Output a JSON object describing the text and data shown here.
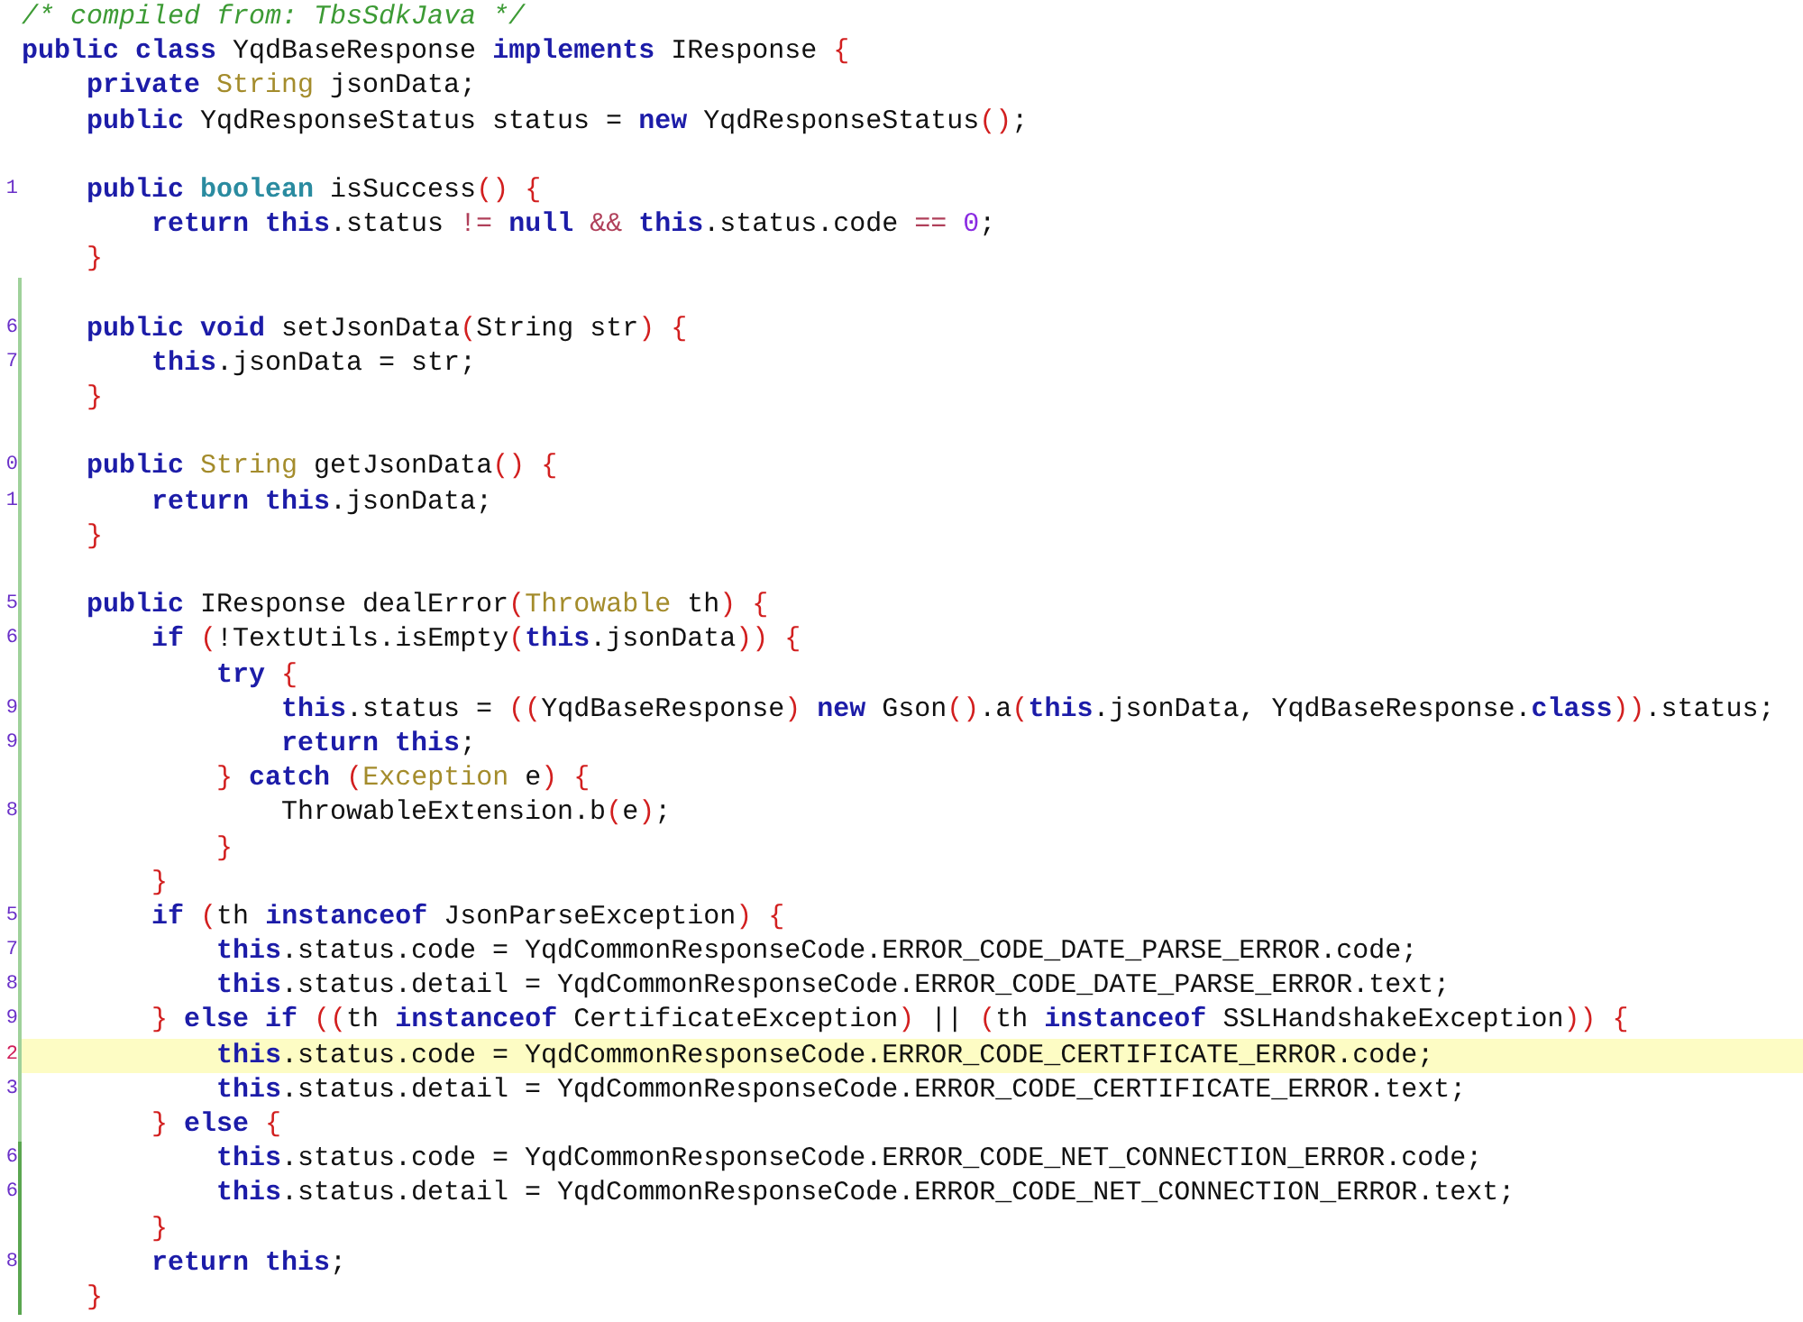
{
  "editor": {
    "lines": [
      {
        "kind": "code",
        "tokens": [
          {
            "kind": "comment",
            "text": "/* compiled from: TbsSdkJava */"
          }
        ]
      },
      {
        "kind": "code",
        "tokens": [
          {
            "kind": "keyword",
            "text": "public class"
          },
          {
            "kind": "plain",
            "text": " YqdBaseResponse "
          },
          {
            "kind": "keyword",
            "text": "implements"
          },
          {
            "kind": "plain",
            "text": " IResponse "
          },
          {
            "kind": "bracket",
            "text": "{"
          }
        ]
      },
      {
        "kind": "code",
        "tokens": [
          {
            "kind": "keyword",
            "text": "    private "
          },
          {
            "kind": "type",
            "text": "String"
          },
          {
            "kind": "plain",
            "text": " jsonData;"
          }
        ]
      },
      {
        "kind": "code",
        "tokens": [
          {
            "kind": "keyword",
            "text": "    public"
          },
          {
            "kind": "plain",
            "text": " YqdResponseStatus status = "
          },
          {
            "kind": "keyword",
            "text": "new"
          },
          {
            "kind": "plain",
            "text": " YqdResponseStatus"
          },
          {
            "kind": "bracket",
            "text": "()"
          },
          {
            "kind": "plain",
            "text": ";"
          }
        ]
      },
      {
        "kind": "blank"
      },
      {
        "kind": "code",
        "gutter": "1",
        "tokens": [
          {
            "kind": "keyword",
            "text": "    public "
          },
          {
            "kind": "primitive",
            "text": "boolean"
          },
          {
            "kind": "plain",
            "text": " isSuccess"
          },
          {
            "kind": "bracket",
            "text": "() {"
          }
        ]
      },
      {
        "kind": "code",
        "tokens": [
          {
            "kind": "keyword",
            "text": "        return this"
          },
          {
            "kind": "plain",
            "text": ".status "
          },
          {
            "kind": "operator",
            "text": "!= "
          },
          {
            "kind": "keyword",
            "text": "null "
          },
          {
            "kind": "operator",
            "text": "&& "
          },
          {
            "kind": "keyword",
            "text": "this"
          },
          {
            "kind": "plain",
            "text": ".status.code "
          },
          {
            "kind": "operator",
            "text": "== "
          },
          {
            "kind": "number",
            "text": "0"
          },
          {
            "kind": "plain",
            "text": ";"
          }
        ]
      },
      {
        "kind": "code",
        "tokens": [
          {
            "kind": "bracket",
            "text": "    }"
          }
        ]
      },
      {
        "kind": "blank",
        "changed": true
      },
      {
        "kind": "code",
        "gutter": "6",
        "changed": true,
        "tokens": [
          {
            "kind": "keyword",
            "text": "    public void"
          },
          {
            "kind": "plain",
            "text": " setJsonData"
          },
          {
            "kind": "bracket",
            "text": "("
          },
          {
            "kind": "plain",
            "text": "String str"
          },
          {
            "kind": "bracket",
            "text": ") {"
          }
        ]
      },
      {
        "kind": "code",
        "gutter": "7",
        "changed": true,
        "tokens": [
          {
            "kind": "keyword",
            "text": "        this"
          },
          {
            "kind": "plain",
            "text": ".jsonData = str;"
          }
        ]
      },
      {
        "kind": "code",
        "changed": true,
        "tokens": [
          {
            "kind": "bracket",
            "text": "    }"
          }
        ]
      },
      {
        "kind": "blank",
        "changed": true
      },
      {
        "kind": "code",
        "gutter": "0",
        "changed": true,
        "tokens": [
          {
            "kind": "keyword",
            "text": "    public "
          },
          {
            "kind": "type",
            "text": "String"
          },
          {
            "kind": "plain",
            "text": " getJsonData"
          },
          {
            "kind": "bracket",
            "text": "() {"
          }
        ]
      },
      {
        "kind": "code",
        "gutter": "1",
        "changed": true,
        "tokens": [
          {
            "kind": "keyword",
            "text": "        return this"
          },
          {
            "kind": "plain",
            "text": ".jsonData;"
          }
        ]
      },
      {
        "kind": "code",
        "changed": true,
        "tokens": [
          {
            "kind": "bracket",
            "text": "    }"
          }
        ]
      },
      {
        "kind": "blank",
        "changed": true
      },
      {
        "kind": "code",
        "gutter": "5",
        "changed": true,
        "tokens": [
          {
            "kind": "keyword",
            "text": "    public"
          },
          {
            "kind": "plain",
            "text": " IResponse dealError"
          },
          {
            "kind": "bracket",
            "text": "("
          },
          {
            "kind": "type",
            "text": "Throwable"
          },
          {
            "kind": "plain",
            "text": " th"
          },
          {
            "kind": "bracket",
            "text": ") {"
          }
        ]
      },
      {
        "kind": "code",
        "gutter": "6",
        "changed": true,
        "tokens": [
          {
            "kind": "keyword",
            "text": "        if "
          },
          {
            "kind": "bracket",
            "text": "("
          },
          {
            "kind": "plain",
            "text": "!TextUtils.isEmpty"
          },
          {
            "kind": "bracket",
            "text": "("
          },
          {
            "kind": "keyword",
            "text": "this"
          },
          {
            "kind": "plain",
            "text": ".jsonData"
          },
          {
            "kind": "bracket",
            "text": ")) {"
          }
        ]
      },
      {
        "kind": "code",
        "changed": true,
        "tokens": [
          {
            "kind": "keyword",
            "text": "            try "
          },
          {
            "kind": "bracket",
            "text": "{"
          }
        ]
      },
      {
        "kind": "code",
        "gutter": "9",
        "changed": true,
        "tokens": [
          {
            "kind": "keyword",
            "text": "                this"
          },
          {
            "kind": "plain",
            "text": ".status = "
          },
          {
            "kind": "bracket",
            "text": "(("
          },
          {
            "kind": "plain",
            "text": "YqdBaseResponse"
          },
          {
            "kind": "bracket",
            "text": ") "
          },
          {
            "kind": "keyword",
            "text": "new"
          },
          {
            "kind": "plain",
            "text": " Gson"
          },
          {
            "kind": "bracket",
            "text": "()"
          },
          {
            "kind": "plain",
            "text": ".a"
          },
          {
            "kind": "bracket",
            "text": "("
          },
          {
            "kind": "keyword",
            "text": "this"
          },
          {
            "kind": "plain",
            "text": ".jsonData, YqdBaseResponse."
          },
          {
            "kind": "keyword",
            "text": "class"
          },
          {
            "kind": "bracket",
            "text": "))"
          },
          {
            "kind": "plain",
            "text": ".status;"
          }
        ]
      },
      {
        "kind": "code",
        "gutter": "9",
        "changed": true,
        "tokens": [
          {
            "kind": "keyword",
            "text": "                return this"
          },
          {
            "kind": "plain",
            "text": ";"
          }
        ]
      },
      {
        "kind": "code",
        "changed": true,
        "tokens": [
          {
            "kind": "bracket",
            "text": "            } "
          },
          {
            "kind": "keyword",
            "text": "catch "
          },
          {
            "kind": "bracket",
            "text": "("
          },
          {
            "kind": "type",
            "text": "Exception"
          },
          {
            "kind": "plain",
            "text": " e"
          },
          {
            "kind": "bracket",
            "text": ") {"
          }
        ]
      },
      {
        "kind": "code",
        "gutter": "8",
        "changed": true,
        "tokens": [
          {
            "kind": "plain",
            "text": "                ThrowableExtension.b"
          },
          {
            "kind": "bracket",
            "text": "("
          },
          {
            "kind": "plain",
            "text": "e"
          },
          {
            "kind": "bracket",
            "text": ")"
          },
          {
            "kind": "plain",
            "text": ";"
          }
        ]
      },
      {
        "kind": "code",
        "changed": true,
        "tokens": [
          {
            "kind": "bracket",
            "text": "            }"
          }
        ]
      },
      {
        "kind": "code",
        "changed": true,
        "tokens": [
          {
            "kind": "bracket",
            "text": "        }"
          }
        ]
      },
      {
        "kind": "code",
        "gutter": "5",
        "changed": true,
        "tokens": [
          {
            "kind": "keyword",
            "text": "        if "
          },
          {
            "kind": "bracket",
            "text": "("
          },
          {
            "kind": "plain",
            "text": "th "
          },
          {
            "kind": "keyword",
            "text": "instanceof"
          },
          {
            "kind": "plain",
            "text": " JsonParseException"
          },
          {
            "kind": "bracket",
            "text": ") {"
          }
        ]
      },
      {
        "kind": "code",
        "gutter": "7",
        "changed": true,
        "tokens": [
          {
            "kind": "keyword",
            "text": "            this"
          },
          {
            "kind": "plain",
            "text": ".status.code = YqdCommonResponseCode.ERROR_CODE_DATE_PARSE_ERROR.code;"
          }
        ]
      },
      {
        "kind": "code",
        "gutter": "8",
        "changed": true,
        "tokens": [
          {
            "kind": "keyword",
            "text": "            this"
          },
          {
            "kind": "plain",
            "text": ".status.detail = YqdCommonResponseCode.ERROR_CODE_DATE_PARSE_ERROR.text;"
          }
        ]
      },
      {
        "kind": "code",
        "gutter": "9",
        "changed": true,
        "tokens": [
          {
            "kind": "bracket",
            "text": "        } "
          },
          {
            "kind": "keyword",
            "text": "else if "
          },
          {
            "kind": "bracket",
            "text": "(("
          },
          {
            "kind": "plain",
            "text": "th "
          },
          {
            "kind": "keyword",
            "text": "instanceof"
          },
          {
            "kind": "plain",
            "text": " CertificateException"
          },
          {
            "kind": "bracket",
            "text": ")"
          },
          {
            "kind": "plain",
            "text": " || "
          },
          {
            "kind": "bracket",
            "text": "("
          },
          {
            "kind": "plain",
            "text": "th "
          },
          {
            "kind": "keyword",
            "text": "instanceof"
          },
          {
            "kind": "plain",
            "text": " SSLHandshakeException"
          },
          {
            "kind": "bracket",
            "text": ")) {"
          }
        ]
      },
      {
        "kind": "code",
        "gutter": "2",
        "changed": true,
        "selected": true,
        "tokens": [
          {
            "kind": "keyword",
            "text": "            this"
          },
          {
            "kind": "plain",
            "text": ".status.code = YqdCommonResponseCode.ERROR_CODE_CERTIFICATE_ERROR.code;"
          }
        ]
      },
      {
        "kind": "code",
        "gutter": "3",
        "changed": true,
        "tokens": [
          {
            "kind": "keyword",
            "text": "            this"
          },
          {
            "kind": "plain",
            "text": ".status.detail = YqdCommonResponseCode.ERROR_CODE_CERTIFICATE_ERROR.text;"
          }
        ]
      },
      {
        "kind": "code",
        "changed": true,
        "tokens": [
          {
            "kind": "bracket",
            "text": "        } "
          },
          {
            "kind": "keyword",
            "text": "else "
          },
          {
            "kind": "bracket",
            "text": "{"
          }
        ]
      },
      {
        "kind": "code",
        "gutter": "6",
        "changed": true,
        "recent": true,
        "tokens": [
          {
            "kind": "keyword",
            "text": "            this"
          },
          {
            "kind": "plain",
            "text": ".status.code = YqdCommonResponseCode.ERROR_CODE_NET_CONNECTION_ERROR.code;"
          }
        ]
      },
      {
        "kind": "code",
        "gutter": "6",
        "changed": true,
        "recent": true,
        "tokens": [
          {
            "kind": "keyword",
            "text": "            this"
          },
          {
            "kind": "plain",
            "text": ".status.detail = YqdCommonResponseCode.ERROR_CODE_NET_CONNECTION_ERROR.text;"
          }
        ]
      },
      {
        "kind": "code",
        "changed": true,
        "recent": true,
        "tokens": [
          {
            "kind": "bracket",
            "text": "        }"
          }
        ]
      },
      {
        "kind": "code",
        "gutter": "8",
        "changed": true,
        "recent": true,
        "tokens": [
          {
            "kind": "keyword",
            "text": "        return this"
          },
          {
            "kind": "plain",
            "text": ";"
          }
        ]
      },
      {
        "kind": "code",
        "changed": true,
        "recent": true,
        "tokens": [
          {
            "kind": "bracket",
            "text": "    }"
          }
        ]
      }
    ]
  }
}
